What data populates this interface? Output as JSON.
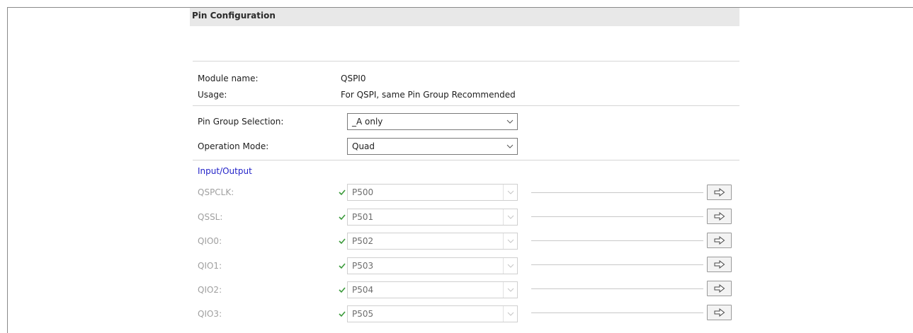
{
  "panel": {
    "title": "Pin Configuration"
  },
  "info": {
    "module_label": "Module name:",
    "module_value": "QSPI0",
    "usage_label": "Usage:",
    "usage_value": "For QSPI, same Pin Group Recommended"
  },
  "settings": {
    "pin_group": {
      "label": "Pin Group Selection:",
      "value": "_A only"
    },
    "operation_mode": {
      "label": "Operation Mode:",
      "value": "Quad"
    }
  },
  "io": {
    "title": "Input/Output",
    "pins": [
      {
        "label": "QSPCLK:",
        "value": "P500"
      },
      {
        "label": "QSSL:",
        "value": "P501"
      },
      {
        "label": "QIO0:",
        "value": "P502"
      },
      {
        "label": "QIO1:",
        "value": "P503"
      },
      {
        "label": "QIO2:",
        "value": "P504"
      },
      {
        "label": "QIO3:",
        "value": "P505"
      }
    ]
  },
  "colors": {
    "link_blue": "#2323c8",
    "check_green": "#3a9a3a",
    "disabled_text": "#a0a0a0"
  },
  "icons": {
    "dropdown": "chevron-down-icon",
    "status": "checkmark-icon",
    "navigate": "arrow-right-icon"
  }
}
